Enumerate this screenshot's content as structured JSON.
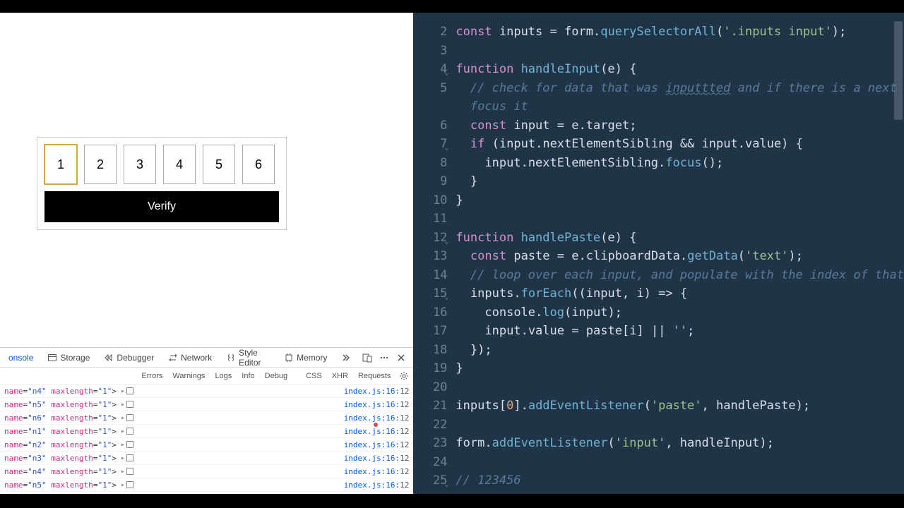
{
  "preview": {
    "inputs": [
      "1",
      "2",
      "3",
      "4",
      "5",
      "6"
    ],
    "active_index": 0,
    "verify_label": "Verify"
  },
  "devtools": {
    "tabs": {
      "console": "onsole",
      "storage": "Storage",
      "debugger": "Debugger",
      "network": "Network",
      "style_editor": "Style Editor",
      "memory": "Memory"
    },
    "filters": [
      "Errors",
      "Warnings",
      "Logs",
      "Info",
      "Debug",
      "CSS",
      "XHR",
      "Requests"
    ],
    "log_location": {
      "file": "index.js",
      "line": 16,
      "col": 12
    },
    "logs": [
      {
        "name": "n4",
        "maxlength": "1"
      },
      {
        "name": "n5",
        "maxlength": "1"
      },
      {
        "name": "n6",
        "maxlength": "1"
      },
      {
        "name": "n1",
        "maxlength": "1"
      },
      {
        "name": "n2",
        "maxlength": "1"
      },
      {
        "name": "n3",
        "maxlength": "1"
      },
      {
        "name": "n4",
        "maxlength": "1"
      },
      {
        "name": "n5",
        "maxlength": "1"
      }
    ]
  },
  "editor": {
    "lines": [
      {
        "n": 2,
        "kind": "code",
        "tokens": [
          [
            "kw",
            "const"
          ],
          [
            "sp",
            " "
          ],
          [
            "var",
            "inputs"
          ],
          [
            "sp",
            " "
          ],
          [
            "op",
            "="
          ],
          [
            "sp",
            " "
          ],
          [
            "var",
            "form"
          ],
          [
            "punc",
            "."
          ],
          [
            "call",
            "querySelectorAll"
          ],
          [
            "punc",
            "("
          ],
          [
            "str",
            "'.inputs input'"
          ],
          [
            "punc",
            ");"
          ]
        ]
      },
      {
        "n": 3,
        "kind": "blank"
      },
      {
        "n": 4,
        "kind": "code",
        "fold": true,
        "tokens": [
          [
            "kw",
            "function"
          ],
          [
            "sp",
            " "
          ],
          [
            "fn",
            "handleInput"
          ],
          [
            "punc",
            "("
          ],
          [
            "var",
            "e"
          ],
          [
            "punc",
            ")"
          ],
          [
            "sp",
            " "
          ],
          [
            "punc",
            "{"
          ]
        ]
      },
      {
        "n": 5,
        "kind": "comment",
        "indent": 1,
        "text": "// check for data that was ",
        "squig": "inputtted",
        "text2": " and if there is a next "
      },
      {
        "n": "",
        "kind": "comment_cont",
        "indent": 1,
        "text": "focus it"
      },
      {
        "n": 6,
        "kind": "code",
        "indent": 1,
        "tokens": [
          [
            "kw",
            "const"
          ],
          [
            "sp",
            " "
          ],
          [
            "var",
            "input"
          ],
          [
            "sp",
            " "
          ],
          [
            "op",
            "="
          ],
          [
            "sp",
            " "
          ],
          [
            "var",
            "e"
          ],
          [
            "punc",
            "."
          ],
          [
            "prop",
            "target"
          ],
          [
            "punc",
            ";"
          ]
        ]
      },
      {
        "n": 7,
        "kind": "code",
        "fold": true,
        "indent": 1,
        "tokens": [
          [
            "kw",
            "if"
          ],
          [
            "sp",
            " "
          ],
          [
            "punc",
            "("
          ],
          [
            "var",
            "input"
          ],
          [
            "punc",
            "."
          ],
          [
            "prop",
            "nextElementSibling"
          ],
          [
            "sp",
            " "
          ],
          [
            "op",
            "&&"
          ],
          [
            "sp",
            " "
          ],
          [
            "var",
            "input"
          ],
          [
            "punc",
            "."
          ],
          [
            "prop",
            "value"
          ],
          [
            "punc",
            ")"
          ],
          [
            "sp",
            " "
          ],
          [
            "punc",
            "{"
          ]
        ]
      },
      {
        "n": 8,
        "kind": "code",
        "indent": 2,
        "tokens": [
          [
            "var",
            "input"
          ],
          [
            "punc",
            "."
          ],
          [
            "prop",
            "nextElementSibling"
          ],
          [
            "punc",
            "."
          ],
          [
            "call",
            "focus"
          ],
          [
            "punc",
            "();"
          ]
        ]
      },
      {
        "n": 9,
        "kind": "code",
        "indent": 1,
        "tokens": [
          [
            "punc",
            "}"
          ]
        ]
      },
      {
        "n": 10,
        "kind": "code",
        "tokens": [
          [
            "punc",
            "}"
          ]
        ]
      },
      {
        "n": 11,
        "kind": "blank"
      },
      {
        "n": 12,
        "kind": "code",
        "fold": true,
        "tokens": [
          [
            "kw",
            "function"
          ],
          [
            "sp",
            " "
          ],
          [
            "fn",
            "handlePaste"
          ],
          [
            "punc",
            "("
          ],
          [
            "var",
            "e"
          ],
          [
            "punc",
            ")"
          ],
          [
            "sp",
            " "
          ],
          [
            "punc",
            "{"
          ]
        ]
      },
      {
        "n": 13,
        "kind": "code",
        "indent": 1,
        "tokens": [
          [
            "kw",
            "const"
          ],
          [
            "sp",
            " "
          ],
          [
            "var",
            "paste"
          ],
          [
            "sp",
            " "
          ],
          [
            "op",
            "="
          ],
          [
            "sp",
            " "
          ],
          [
            "var",
            "e"
          ],
          [
            "punc",
            "."
          ],
          [
            "prop",
            "clipboardData"
          ],
          [
            "punc",
            "."
          ],
          [
            "call",
            "getData"
          ],
          [
            "punc",
            "("
          ],
          [
            "str",
            "'text'"
          ],
          [
            "punc",
            ");"
          ]
        ]
      },
      {
        "n": 14,
        "kind": "comment",
        "indent": 1,
        "text": "// loop over each input, and populate with the index of that"
      },
      {
        "n": 15,
        "kind": "code",
        "fold": true,
        "indent": 1,
        "tokens": [
          [
            "var",
            "inputs"
          ],
          [
            "punc",
            "."
          ],
          [
            "call",
            "forEach"
          ],
          [
            "punc",
            "(("
          ],
          [
            "var",
            "input"
          ],
          [
            "punc",
            ","
          ],
          [
            "sp",
            " "
          ],
          [
            "var",
            "i"
          ],
          [
            "punc",
            ")"
          ],
          [
            "sp",
            " "
          ],
          [
            "op",
            "=>"
          ],
          [
            "sp",
            " "
          ],
          [
            "punc",
            "{"
          ]
        ]
      },
      {
        "n": 16,
        "kind": "code",
        "indent": 2,
        "tokens": [
          [
            "var",
            "console"
          ],
          [
            "punc",
            "."
          ],
          [
            "call",
            "log"
          ],
          [
            "punc",
            "("
          ],
          [
            "var",
            "input"
          ],
          [
            "punc",
            ");"
          ]
        ]
      },
      {
        "n": 17,
        "kind": "code",
        "indent": 2,
        "tokens": [
          [
            "var",
            "input"
          ],
          [
            "punc",
            "."
          ],
          [
            "prop",
            "value"
          ],
          [
            "sp",
            " "
          ],
          [
            "op",
            "="
          ],
          [
            "sp",
            " "
          ],
          [
            "var",
            "paste"
          ],
          [
            "punc",
            "["
          ],
          [
            "var",
            "i"
          ],
          [
            "punc",
            "]"
          ],
          [
            "sp",
            " "
          ],
          [
            "op",
            "||"
          ],
          [
            "sp",
            " "
          ],
          [
            "str",
            "''"
          ],
          [
            "punc",
            ";"
          ]
        ]
      },
      {
        "n": 18,
        "kind": "code",
        "indent": 1,
        "tokens": [
          [
            "punc",
            "});"
          ]
        ]
      },
      {
        "n": 19,
        "kind": "code",
        "tokens": [
          [
            "punc",
            "}"
          ]
        ]
      },
      {
        "n": 20,
        "kind": "blank"
      },
      {
        "n": 21,
        "kind": "code",
        "tokens": [
          [
            "var",
            "inputs"
          ],
          [
            "punc",
            "["
          ],
          [
            "num",
            "0"
          ],
          [
            "punc",
            "]."
          ],
          [
            "call",
            "addEventListener"
          ],
          [
            "punc",
            "("
          ],
          [
            "str",
            "'paste'"
          ],
          [
            "punc",
            ","
          ],
          [
            "sp",
            " "
          ],
          [
            "var",
            "handlePaste"
          ],
          [
            "punc",
            ");"
          ]
        ]
      },
      {
        "n": 22,
        "kind": "blank",
        "dot": true
      },
      {
        "n": 23,
        "kind": "code",
        "tokens": [
          [
            "var",
            "form"
          ],
          [
            "punc",
            "."
          ],
          [
            "call",
            "addEventListener"
          ],
          [
            "punc",
            "("
          ],
          [
            "str",
            "'input'"
          ],
          [
            "punc",
            ","
          ],
          [
            "sp",
            " "
          ],
          [
            "var",
            "handleInput"
          ],
          [
            "punc",
            ");"
          ]
        ]
      },
      {
        "n": 24,
        "kind": "blank"
      },
      {
        "n": 25,
        "kind": "comment",
        "fold": true,
        "text": "// 123456"
      }
    ]
  }
}
